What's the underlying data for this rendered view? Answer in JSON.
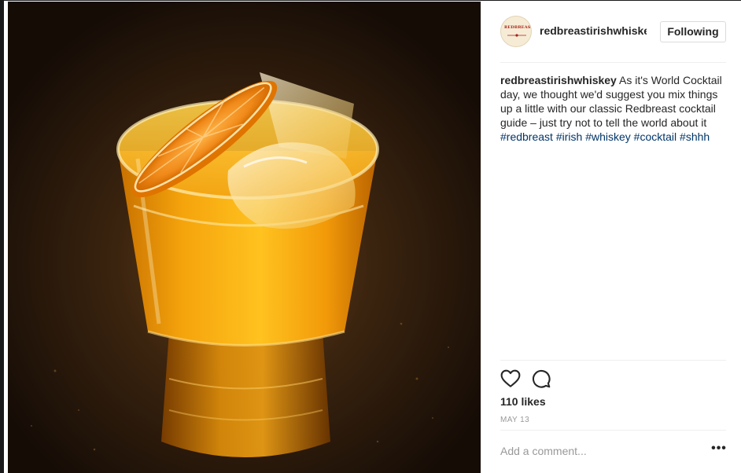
{
  "post": {
    "username": "redbreastirishwhiskey",
    "follow_label": "Following",
    "avatar_logo_text": "REDBREAST",
    "caption": {
      "username": "redbreastirishwhiskey",
      "text": "As it's World Cocktail day, we thought we'd suggest you mix things up a little with our classic Redbreast cocktail guide – just try not to tell the world about it",
      "hashtags": [
        "#redbreast",
        "#irish",
        "#whiskey",
        "#cocktail",
        "#shhh"
      ]
    },
    "likes": "110 likes",
    "date": "MAY 13",
    "comment_placeholder": "Add a comment...",
    "more_label": "•••"
  },
  "icons": {
    "like": "heart-icon",
    "comment": "comment-bubble-icon",
    "more": "more-options-icon"
  },
  "colors": {
    "hashtag": "#003569",
    "muted": "#999999",
    "text": "#262626",
    "divider": "#efefef"
  }
}
